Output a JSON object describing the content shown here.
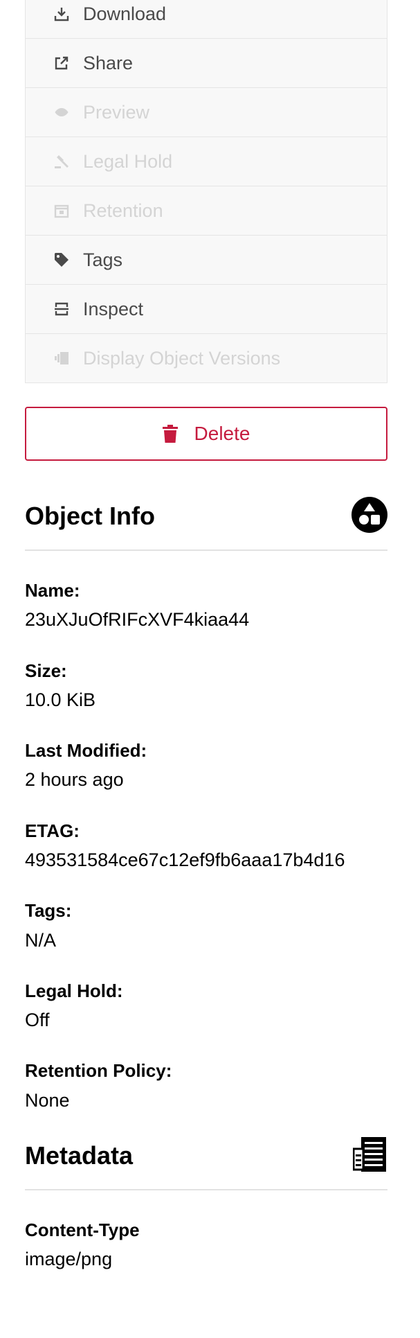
{
  "actions": [
    {
      "label": "Download",
      "icon": "download-icon",
      "disabled": false
    },
    {
      "label": "Share",
      "icon": "share-icon",
      "disabled": false
    },
    {
      "label": "Preview",
      "icon": "eye-icon",
      "disabled": true
    },
    {
      "label": "Legal Hold",
      "icon": "gavel-icon",
      "disabled": true
    },
    {
      "label": "Retention",
      "icon": "retention-icon",
      "disabled": true
    },
    {
      "label": "Tags",
      "icon": "tag-icon",
      "disabled": false
    },
    {
      "label": "Inspect",
      "icon": "inspect-icon",
      "disabled": false
    },
    {
      "label": "Display Object Versions",
      "icon": "versions-icon",
      "disabled": true
    }
  ],
  "delete": {
    "label": "Delete",
    "color": "#c51b3e"
  },
  "object_info": {
    "title": "Object Info",
    "fields": [
      {
        "label": "Name:",
        "value": "23uXJuOfRIFcXVF4kiaa44"
      },
      {
        "label": "Size:",
        "value": "10.0 KiB"
      },
      {
        "label": "Last Modified:",
        "value": "2 hours ago"
      },
      {
        "label": "ETAG:",
        "value": "493531584ce67c12ef9fb6aaa17b4d16"
      },
      {
        "label": "Tags:",
        "value": "N/A"
      },
      {
        "label": "Legal Hold:",
        "value": "Off"
      },
      {
        "label": "Retention Policy:",
        "value": "None"
      }
    ]
  },
  "metadata": {
    "title": "Metadata",
    "fields": [
      {
        "label": "Content-Type",
        "value": "image/png"
      }
    ]
  }
}
